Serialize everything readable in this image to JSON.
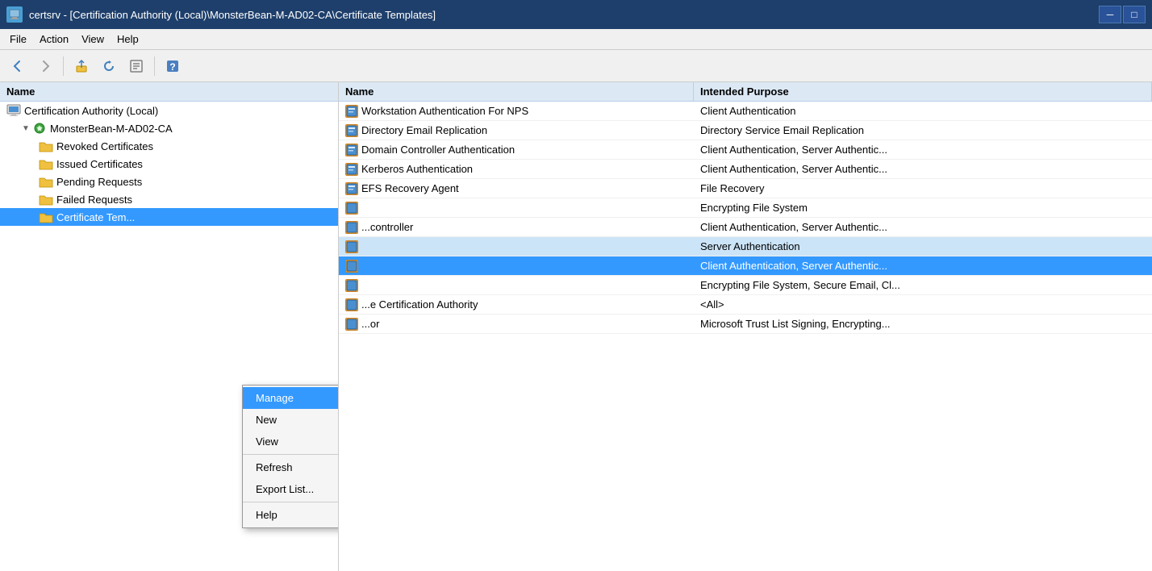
{
  "titleBar": {
    "title": "certsrv - [Certification Authority (Local)\\MonsterBean-M-AD02-CA\\Certificate Templates]",
    "minimizeLabel": "─",
    "maximizeLabel": "□"
  },
  "menuBar": {
    "items": [
      "File",
      "Action",
      "View",
      "Help"
    ]
  },
  "toolbar": {
    "buttons": [
      "back",
      "forward",
      "up",
      "refresh",
      "export",
      "help"
    ]
  },
  "tree": {
    "header": "Certification Authority (Local)",
    "rootLabel": "Certification Authority (Local)",
    "caNode": "MonsterBean-M-AD02-CA",
    "children": [
      {
        "label": "Revoked Certificates",
        "icon": "folder"
      },
      {
        "label": "Issued Certificates",
        "icon": "folder"
      },
      {
        "label": "Pending Requests",
        "icon": "folder"
      },
      {
        "label": "Failed Requests",
        "icon": "folder"
      },
      {
        "label": "Certificate Tem...",
        "icon": "folder",
        "selected": true
      }
    ]
  },
  "columns": {
    "name": "Name",
    "purpose": "Intended Purpose"
  },
  "tableRows": [
    {
      "name": "Workstation Authentication For NPS",
      "purpose": "Client Authentication"
    },
    {
      "name": "Directory Email Replication",
      "purpose": "Directory Service Email Replication"
    },
    {
      "name": "Domain Controller Authentication",
      "purpose": "Client Authentication, Server Authentic..."
    },
    {
      "name": "Kerberos Authentication",
      "purpose": "Client Authentication, Server Authentic..."
    },
    {
      "name": "EFS Recovery Agent",
      "purpose": "File Recovery"
    },
    {
      "name": "",
      "purpose": "Encrypting File System"
    },
    {
      "name": "...controller",
      "purpose": "Client Authentication, Server Authentic..."
    },
    {
      "name": "",
      "purpose": "Server Authentication",
      "highlighted": true
    },
    {
      "name": "",
      "purpose": "Client Authentication, Server Authentic...",
      "selected": true
    },
    {
      "name": "",
      "purpose": "Encrypting File System, Secure Email, Cl..."
    },
    {
      "name": "...e Certification Authority",
      "purpose": "<All>"
    },
    {
      "name": "...or",
      "purpose": "Microsoft Trust List Signing, Encrypting..."
    }
  ],
  "contextMenu": {
    "items": [
      {
        "label": "Manage",
        "hasArrow": false,
        "highlighted": true
      },
      {
        "label": "New",
        "hasArrow": true
      },
      {
        "label": "View",
        "hasArrow": true
      },
      {
        "label": "Refresh",
        "hasArrow": false
      },
      {
        "label": "Export List...",
        "hasArrow": false
      },
      {
        "label": "Help",
        "hasArrow": false
      }
    ]
  }
}
